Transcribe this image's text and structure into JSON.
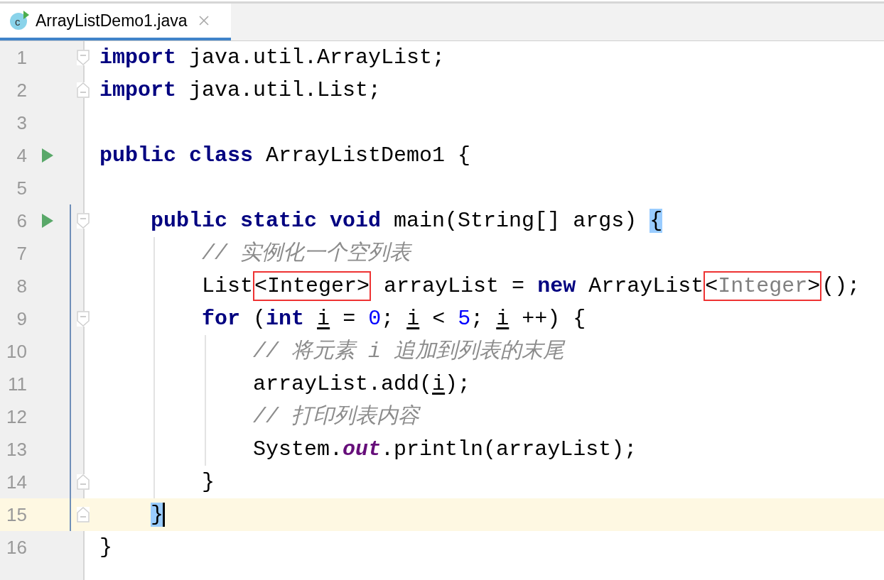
{
  "tab": {
    "title": "ArrayListDemo1.java",
    "icon_letter": "c",
    "selected": true
  },
  "lines": [
    {
      "number": "1",
      "run": false,
      "fold_open": true,
      "fold_close": false,
      "changed": false,
      "current": false,
      "tokens": [
        {
          "kind": "kw",
          "text": "import"
        },
        {
          "kind": "plain",
          "text": " java.util.ArrayList;"
        }
      ]
    },
    {
      "number": "2",
      "run": false,
      "fold_open": false,
      "fold_close": true,
      "changed": false,
      "current": false,
      "tokens": [
        {
          "kind": "kw",
          "text": "import"
        },
        {
          "kind": "plain",
          "text": " java.util.List;"
        }
      ]
    },
    {
      "number": "3",
      "run": false,
      "fold_open": false,
      "fold_close": false,
      "changed": false,
      "current": false
    },
    {
      "number": "4",
      "run": true,
      "fold_open": false,
      "fold_close": false,
      "changed": false,
      "current": false,
      "tokens": [
        {
          "kind": "kw",
          "text": "public class"
        },
        {
          "kind": "plain",
          "text": " ArrayListDemo1 {"
        }
      ]
    },
    {
      "number": "5",
      "run": false,
      "fold_open": false,
      "fold_close": false,
      "changed": false,
      "current": false
    },
    {
      "number": "6",
      "run": true,
      "fold_open": true,
      "fold_close": false,
      "changed": true,
      "current": false,
      "tokens": [
        {
          "kind": "kw",
          "text": "    public static void"
        },
        {
          "kind": "plain",
          "text": " main(String[] args) "
        },
        {
          "kind": "match",
          "text": "{"
        }
      ]
    },
    {
      "number": "7",
      "run": false,
      "fold_open": false,
      "fold_close": false,
      "changed": true,
      "current": false,
      "tokens": [
        {
          "kind": "comment",
          "text": "        // 实例化一个空列表"
        }
      ]
    },
    {
      "number": "8",
      "run": false,
      "fold_open": false,
      "fold_close": false,
      "changed": true,
      "current": false,
      "tokens": [
        {
          "kind": "plain",
          "text": "        List"
        },
        {
          "kind": "boxed",
          "tokens": [
            {
              "kind": "plain",
              "text": "<Integer>"
            }
          ]
        },
        {
          "kind": "plain",
          "text": " arrayList = "
        },
        {
          "kind": "kw",
          "text": "new"
        },
        {
          "kind": "plain",
          "text": " ArrayList"
        },
        {
          "kind": "boxed",
          "tokens": [
            {
              "kind": "plain",
              "text": "<"
            },
            {
              "kind": "hint",
              "text": "Integer"
            },
            {
              "kind": "plain",
              "text": ">"
            }
          ]
        },
        {
          "kind": "plain",
          "text": "();"
        }
      ]
    },
    {
      "number": "9",
      "run": false,
      "fold_open": true,
      "fold_close": false,
      "changed": true,
      "current": false,
      "tokens": [
        {
          "kind": "kw",
          "text": "        for"
        },
        {
          "kind": "plain",
          "text": " ("
        },
        {
          "kind": "kw",
          "text": "int"
        },
        {
          "kind": "var",
          "text": " i"
        },
        {
          "kind": "plain",
          "text": " = "
        },
        {
          "kind": "num",
          "text": "0"
        },
        {
          "kind": "plain",
          "text": "; "
        },
        {
          "kind": "var",
          "text": "i"
        },
        {
          "kind": "plain",
          "text": " < "
        },
        {
          "kind": "num",
          "text": "5"
        },
        {
          "kind": "plain",
          "text": "; "
        },
        {
          "kind": "var",
          "text": "i"
        },
        {
          "kind": "plain",
          "text": " ++) {"
        }
      ]
    },
    {
      "number": "10",
      "run": false,
      "fold_open": false,
      "fold_close": false,
      "changed": true,
      "current": false,
      "tokens": [
        {
          "kind": "comment",
          "text": "            // 将元素 i 追加到列表的末尾"
        }
      ]
    },
    {
      "number": "11",
      "run": false,
      "fold_open": false,
      "fold_close": false,
      "changed": true,
      "current": false,
      "tokens": [
        {
          "kind": "plain",
          "text": "            arrayList.add("
        },
        {
          "kind": "var",
          "text": "i"
        },
        {
          "kind": "plain",
          "text": ");"
        }
      ]
    },
    {
      "number": "12",
      "run": false,
      "fold_open": false,
      "fold_close": false,
      "changed": true,
      "current": false,
      "tokens": [
        {
          "kind": "comment",
          "text": "            // 打印列表内容"
        }
      ]
    },
    {
      "number": "13",
      "run": false,
      "fold_open": false,
      "fold_close": false,
      "changed": true,
      "current": false,
      "tokens": [
        {
          "kind": "plain",
          "text": "            System."
        },
        {
          "kind": "field",
          "text": "out"
        },
        {
          "kind": "plain",
          "text": ".println(arrayList);"
        }
      ]
    },
    {
      "number": "14",
      "run": false,
      "fold_open": false,
      "fold_close": true,
      "changed": true,
      "current": false,
      "tokens": [
        {
          "kind": "plain",
          "text": "        }"
        }
      ]
    },
    {
      "number": "15",
      "run": false,
      "fold_open": false,
      "fold_close": true,
      "changed": true,
      "current": true,
      "tokens": [
        {
          "kind": "match",
          "text": "    }",
          "caret": true
        }
      ]
    },
    {
      "number": "16",
      "run": false,
      "fold_open": false,
      "fold_close": false,
      "changed": false,
      "current": false,
      "tokens": [
        {
          "kind": "plain",
          "text": "}"
        }
      ]
    }
  ]
}
